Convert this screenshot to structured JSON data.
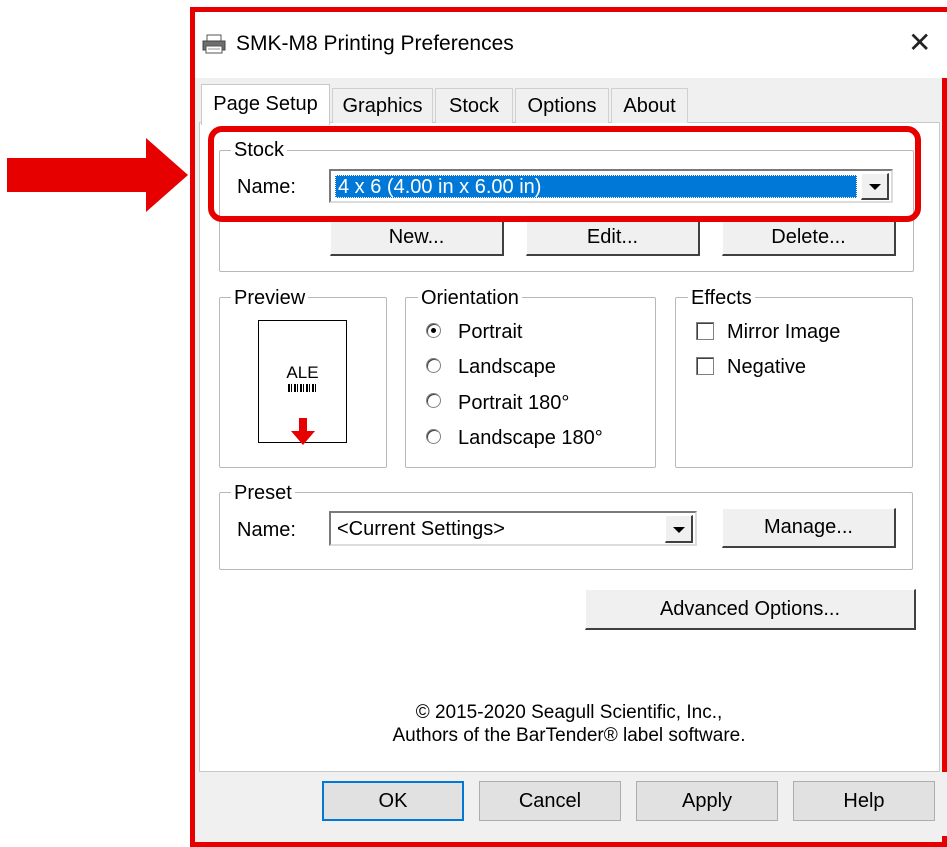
{
  "window": {
    "title": "SMK-M8 Printing Preferences",
    "close_glyph": "✕",
    "printer_icon": "printer-icon"
  },
  "tabs": [
    {
      "label": "Page Setup",
      "active": true
    },
    {
      "label": "Graphics",
      "active": false
    },
    {
      "label": "Stock",
      "active": false
    },
    {
      "label": "Options",
      "active": false
    },
    {
      "label": "About",
      "active": false
    }
  ],
  "stock": {
    "legend": "Stock",
    "name_label": "Name:",
    "name_value": "4 x 6 (4.00 in x 6.00 in)",
    "buttons": {
      "new": "New...",
      "edit": "Edit...",
      "delete": "Delete..."
    }
  },
  "preview": {
    "legend": "Preview",
    "label_text": "ALE",
    "arrow_color": "#e60000"
  },
  "orientation": {
    "legend": "Orientation",
    "options": [
      "Portrait",
      "Landscape",
      "Portrait 180°",
      "Landscape 180°"
    ],
    "selected": "Portrait"
  },
  "effects": {
    "legend": "Effects",
    "options": [
      {
        "label": "Mirror Image",
        "checked": false
      },
      {
        "label": "Negative",
        "checked": false
      }
    ]
  },
  "preset": {
    "legend": "Preset",
    "name_label": "Name:",
    "name_value": "<Current Settings>",
    "manage": "Manage..."
  },
  "advanced_options": "Advanced Options...",
  "copyright": {
    "line1": "© 2015-2020 Seagull Scientific, Inc.,",
    "line2": "Authors of the BarTender® label software."
  },
  "footer": {
    "ok": "OK",
    "cancel": "Cancel",
    "apply": "Apply",
    "help": "Help"
  },
  "colors": {
    "annotation": "#e60000",
    "selection": "#0078d7",
    "ok_border": "#0078d7"
  }
}
